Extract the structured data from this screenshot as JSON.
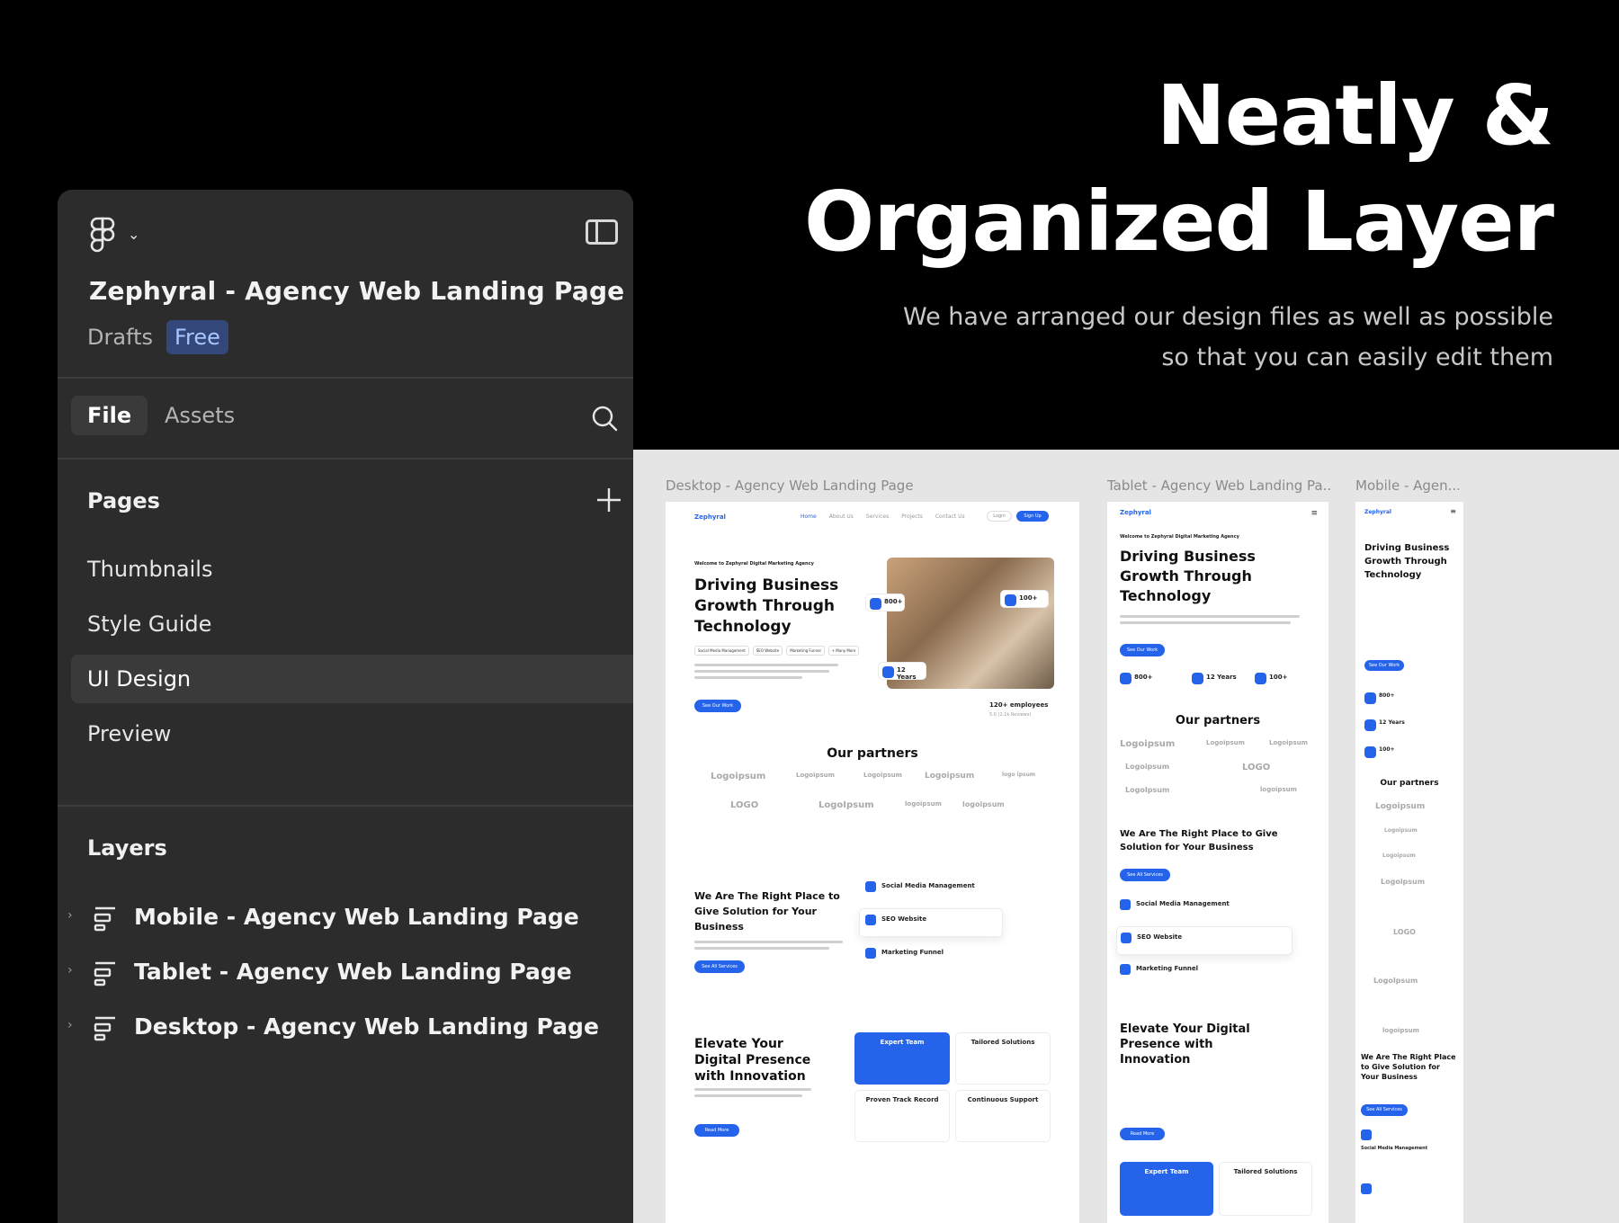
{
  "hero": {
    "line1": "Neatly &",
    "line2": "Organized Layer",
    "sub1": "We have arranged our design files as well as possible",
    "sub2": "so that you can easily edit them"
  },
  "panel": {
    "file_title": "Zephyral - Agency Web Landing Page",
    "drafts": "Drafts",
    "plan_badge": "Free",
    "tabs": {
      "file": "File",
      "assets": "Assets"
    },
    "pages_title": "Pages",
    "pages": [
      "Thumbnails",
      "Style Guide",
      "UI Design",
      "Preview"
    ],
    "layers_title": "Layers",
    "layers": [
      "Mobile - Agency Web Landing Page",
      "Tablet - Agency Web Landing Page",
      "Desktop - Agency Web Landing Page"
    ]
  },
  "canvas": {
    "desktop_label": "Desktop - Agency Web Landing Page",
    "tablet_label": "Tablet - Agency Web Landing Pa...",
    "mobile_label": "Mobile - Agen...",
    "brand": "Zephyral",
    "nav": [
      "Home",
      "About Us",
      "Services",
      "Projects",
      "Contact Us"
    ],
    "login": "Login",
    "signup": "Sign Up",
    "eyebrow": "Welcome to Zephyral Digital Marketing Agency",
    "hero_title": "Driving Business Growth Through Technology",
    "tags": [
      "Social Media Management",
      "SEO Website",
      "Marketing Funnel",
      "+ Many More"
    ],
    "cta": "See Our Work",
    "stats": [
      {
        "value": "800+",
        "label": "Project Completed"
      },
      {
        "value": "12 Years",
        "label": "Experience"
      },
      {
        "value": "100+",
        "label": "Happy Clients"
      }
    ],
    "employees": "120+ employees",
    "rating": "5.0 (2.1k Reviews)",
    "partners_title": "Our partners",
    "partner_logos": [
      "Logoipsum",
      "Logoipsum",
      "Logoipsum",
      "Logoipsum",
      "logo ipsum",
      "LOGO",
      "LogoIpsum",
      "logoipsum",
      "logoipsum"
    ],
    "services_title": "We Are The Right Place to Give Solution for Your Business",
    "services_cta": "See All Services",
    "services": [
      "Social Media Management",
      "SEO Website",
      "Marketing Funnel"
    ],
    "elevate_title": "Elevate Your Digital Presence with Innovation",
    "read_more": "Read More",
    "features": [
      "Expert Team",
      "Tailored Solutions",
      "Proven Track Record",
      "Continuous Support"
    ]
  },
  "colors": {
    "accent": "#2563eb",
    "panel": "#2c2c2c",
    "badge": "#33477a"
  }
}
